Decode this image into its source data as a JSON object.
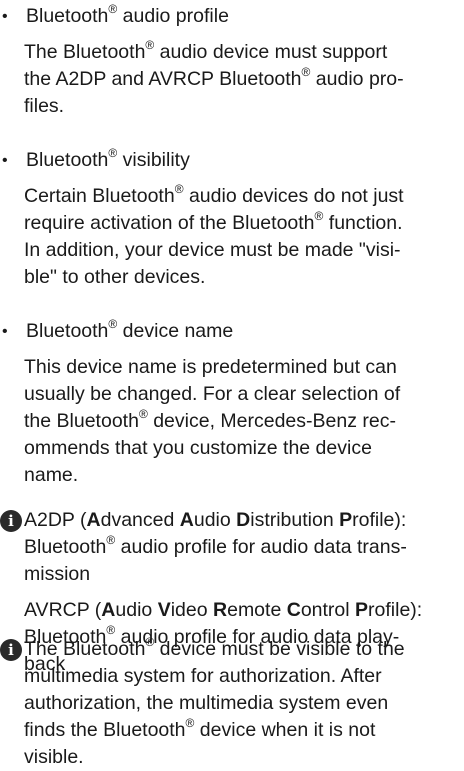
{
  "bullets": [
    {
      "title": "Bluetooth® audio profile",
      "body": "The Bluetooth® audio device must support the A2DP and AVRCP Bluetooth® audio profiles."
    },
    {
      "title": "Bluetooth® visibility",
      "body": "Certain Bluetooth® audio devices do not just require activation of the Bluetooth® function. In addition, your device must be made \"visible\" to other devices."
    },
    {
      "title": "Bluetooth® device name",
      "body": "This device name is predetermined but can usually be changed. For a clear selection of the Bluetooth® device, Mercedes-Benz recommends that you customize the device name."
    }
  ],
  "notes": [
    {
      "icon": "info-icon",
      "a2dp_term": "A2DP (Advanced Audio Distribution Profile):",
      "a2dp_desc": "Bluetooth® audio profile for audio data transmission",
      "avrcp_term": "AVRCP (Audio Video Remote Control Profile):",
      "avrcp_desc": "Bluetooth® audio profile for audio data playback"
    },
    {
      "icon": "info-icon",
      "text": "The Bluetooth® device must be visible to the multimedia system for authorization. After authorization, the multimedia system even finds the Bluetooth® device when it is not visible."
    }
  ]
}
